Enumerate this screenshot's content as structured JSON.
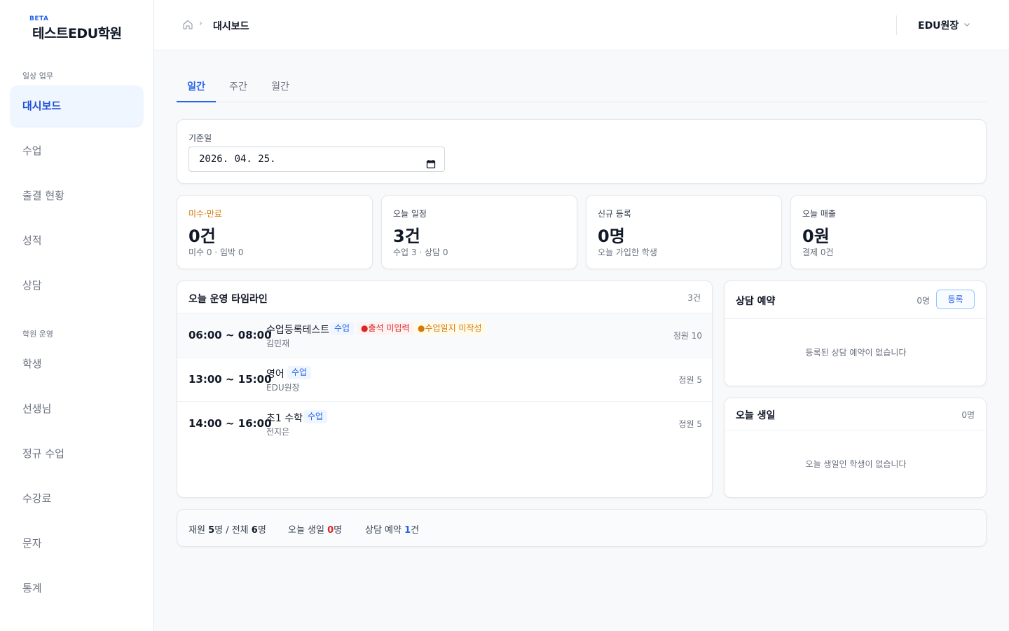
{
  "brand": {
    "beta": "BETA",
    "name": "테스트EDU학원"
  },
  "sidebar": {
    "section1": "일상 업무",
    "section2": "학원 운영",
    "items": [
      {
        "label": "대시보드"
      },
      {
        "label": "수업"
      },
      {
        "label": "출결 현황"
      },
      {
        "label": "성적"
      },
      {
        "label": "상담"
      },
      {
        "label": "학생"
      },
      {
        "label": "선생님"
      },
      {
        "label": "정규 수업"
      },
      {
        "label": "수강료"
      },
      {
        "label": "문자"
      },
      {
        "label": "통계"
      }
    ]
  },
  "header": {
    "breadcrumb": "대시보드",
    "user": "EDU원장"
  },
  "tabs": [
    "일간",
    "주간",
    "월간"
  ],
  "date": {
    "label": "기준일",
    "value": "2026. 04. 25."
  },
  "stats": [
    {
      "label": "미수·만료",
      "value": "0건",
      "sub": "미수 0 · 임박 0"
    },
    {
      "label": "오늘 일정",
      "value": "3건",
      "sub": "수업 3 · 상담 0"
    },
    {
      "label": "신규 등록",
      "value": "0명",
      "sub": "오늘 가입한 학생"
    },
    {
      "label": "오늘 매출",
      "value": "0원",
      "sub": "결제 0건"
    }
  ],
  "timeline": {
    "title": "오늘 운영 타임라인",
    "count": "3건",
    "rows": [
      {
        "time": "06:00 ~ 08:00",
        "name": "수업등록테스트",
        "badge": "수업",
        "alert1": "●출석 미입력",
        "alert2": "●수업일지 미작성",
        "teacher": "김민재",
        "capacity": "정원 10"
      },
      {
        "time": "13:00 ~ 15:00",
        "name": "영어",
        "badge": "수업",
        "teacher": "EDU원장",
        "capacity": "정원 5"
      },
      {
        "time": "14:00 ~ 16:00",
        "name": "초1 수학",
        "badge": "수업",
        "teacher": "전지은",
        "capacity": "정원 5"
      }
    ]
  },
  "consult": {
    "title": "상담 예약",
    "count": "0명",
    "button": "등록",
    "empty": "등록된 상담 예약이 없습니다"
  },
  "birthday": {
    "title": "오늘 생일",
    "count": "0명",
    "empty": "오늘 생일인 학생이 없습니다"
  },
  "summary": {
    "enrolled_label": "재원",
    "enrolled": "5",
    "enrolled_unit": "명 / 전체",
    "total": "6",
    "total_unit": "명",
    "bday_label": "오늘 생일",
    "bday": "0",
    "bday_unit": "명",
    "consult_label": "상담 예약",
    "consult": "1",
    "consult_unit": "건"
  },
  "colors": {
    "accent": "#2563eb",
    "warning": "#d97706",
    "danger": "#dc2626"
  }
}
